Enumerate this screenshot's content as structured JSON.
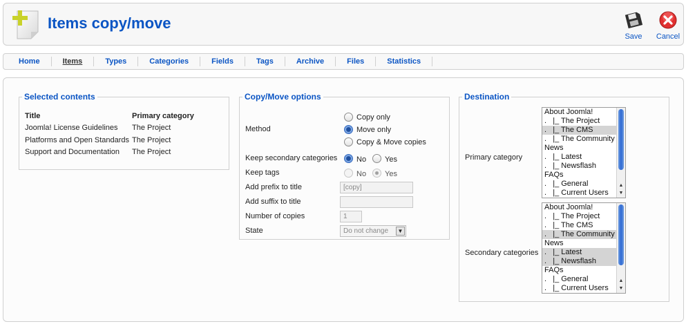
{
  "header": {
    "title": "Items copy/move",
    "toolbar": {
      "save_label": "Save",
      "cancel_label": "Cancel"
    }
  },
  "menu": {
    "items": [
      "Home",
      "Items",
      "Types",
      "Categories",
      "Fields",
      "Tags",
      "Archive",
      "Files",
      "Statistics"
    ],
    "active": "Items"
  },
  "selected": {
    "legend": "Selected contents",
    "columns": [
      "Title",
      "Primary category"
    ],
    "rows": [
      [
        "Joomla! License Guidelines",
        "The Project"
      ],
      [
        "Platforms and Open Standards",
        "The Project"
      ],
      [
        "Support and Documentation",
        "The Project"
      ]
    ]
  },
  "options": {
    "legend": "Copy/Move options",
    "method_label": "Method",
    "method_options": [
      "Copy only",
      "Move only",
      "Copy & Move copies"
    ],
    "method_selected": "Move only",
    "keep_secondary_label": "Keep secondary categories",
    "keep_tags_label": "Keep tags",
    "yes_no": [
      "No",
      "Yes"
    ],
    "keep_secondary_selected": "No",
    "keep_tags_selected": "Yes",
    "prefix_label": "Add prefix to title",
    "prefix_value": "[copy]",
    "suffix_label": "Add suffix to title",
    "suffix_value": "",
    "copies_label": "Number of copies",
    "copies_value": "1",
    "state_label": "State",
    "state_value": "Do not change"
  },
  "destination": {
    "legend": "Destination",
    "primary_label": "Primary category",
    "secondary_label": "Secondary categories",
    "primary_options": [
      "About Joomla!",
      ".   |_ The Project",
      ".   |_ The CMS",
      ".   |_ The Community",
      "News",
      ".   |_ Latest",
      ".   |_ Newsflash",
      "FAQs",
      ".   |_ General",
      ".   |_ Current Users"
    ],
    "primary_selected": [
      2
    ],
    "secondary_options": [
      "About Joomla!",
      ".   |_ The Project",
      ".   |_ The CMS",
      ".   |_ The Community",
      "News",
      ".   |_ Latest",
      ".   |_ Newsflash",
      "FAQs",
      ".   |_ General",
      ".   |_ Current Users"
    ],
    "secondary_selected": [
      3,
      5,
      6
    ]
  },
  "colors": {
    "accent": "#0b55c4",
    "cancel": "#e03030"
  }
}
